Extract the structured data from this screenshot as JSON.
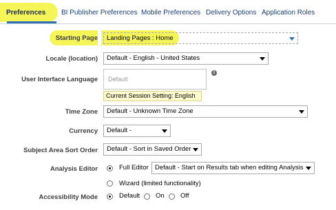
{
  "tabs": {
    "preferences": "Preferences",
    "bi_publisher": "BI Publisher Preferences",
    "mobile": "Mobile Preferences",
    "delivery": "Delivery Options",
    "roles": "Application Roles"
  },
  "form": {
    "starting_page": {
      "label": "Starting Page",
      "value": "Landing Pages : Home"
    },
    "locale": {
      "label": "Locale (location)",
      "value": "Default - English - United States"
    },
    "ui_language": {
      "label": "User Interface Language",
      "placeholder": "Default",
      "note": "Current Session Setting: English"
    },
    "time_zone": {
      "label": "Time Zone",
      "value": "Default - Unknown Time Zone"
    },
    "currency": {
      "label": "Currency",
      "value": "Default -"
    },
    "sort_order": {
      "label": "Subject Area Sort Order",
      "value": "Default - Sort in Saved Order"
    },
    "analysis_editor": {
      "label": "Analysis Editor",
      "full_editor": "Full Editor",
      "full_editor_value": "Default - Start on Results tab when editing Analysis",
      "wizard": "Wizard (limited functionality)",
      "selected": "full"
    },
    "accessibility": {
      "label": "Accessibility Mode",
      "default": "Default",
      "on": "On",
      "off": "Off",
      "selected": "default"
    }
  },
  "colors": {
    "highlight": "#f5f55a",
    "accent": "#2d6db3"
  }
}
